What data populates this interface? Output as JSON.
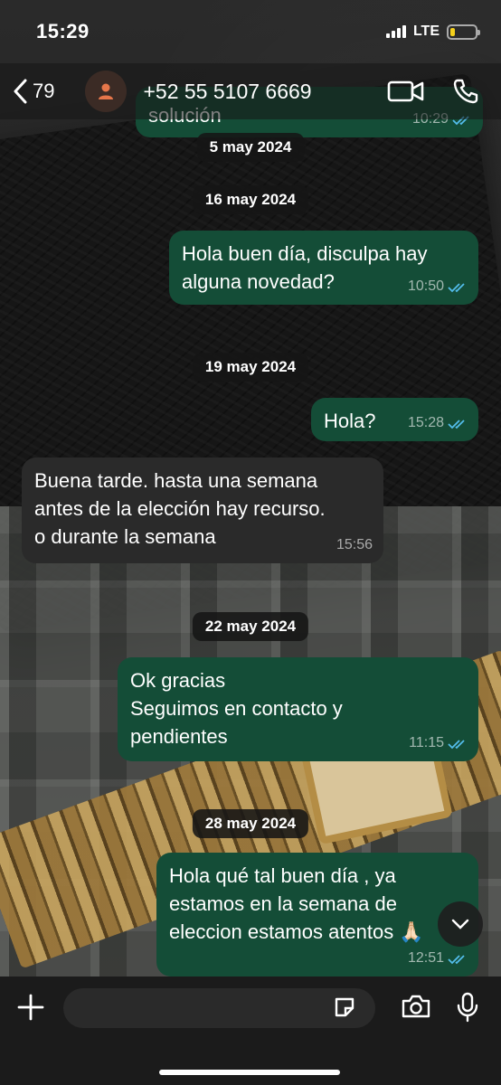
{
  "status_bar": {
    "time": "15:29",
    "network": "LTE",
    "battery_level": 0.18,
    "battery_color": "#f5d11c"
  },
  "header": {
    "back_count": "79",
    "contact_name": "+52 55 5107 6669",
    "avatar_color": "#e5764a"
  },
  "messages": {
    "partial_top": {
      "text": "solución",
      "time": "10:29"
    },
    "date_1": "5 may 2024",
    "date_2": "16 may 2024",
    "m1": {
      "text": "Hola buen día, disculpa hay\nalguna novedad?",
      "time": "10:50"
    },
    "date_3": "19 may 2024",
    "m2": {
      "text": "Hola?",
      "time": "15:28"
    },
    "m3": {
      "text": "Buena tarde. hasta una semana\nantes de la elección hay recurso.\no durante la semana",
      "time": "15:56"
    },
    "date_4": "22 may 2024",
    "m4": {
      "text": "Ok gracias\nSeguimos en contacto y\npendientes",
      "time": "11:15"
    },
    "date_5": "28 may 2024",
    "m5": {
      "text": "Hola qué tal buen día , ya\nestamos en la semana de\neleccion estamos atentos 🙏🏻",
      "time": "12:51"
    }
  },
  "colors": {
    "outgoing_bubble": "#144d37",
    "incoming_bubble": "#2a2a2a",
    "read_ticks": "#53bdeb"
  },
  "composer": {
    "placeholder": ""
  }
}
